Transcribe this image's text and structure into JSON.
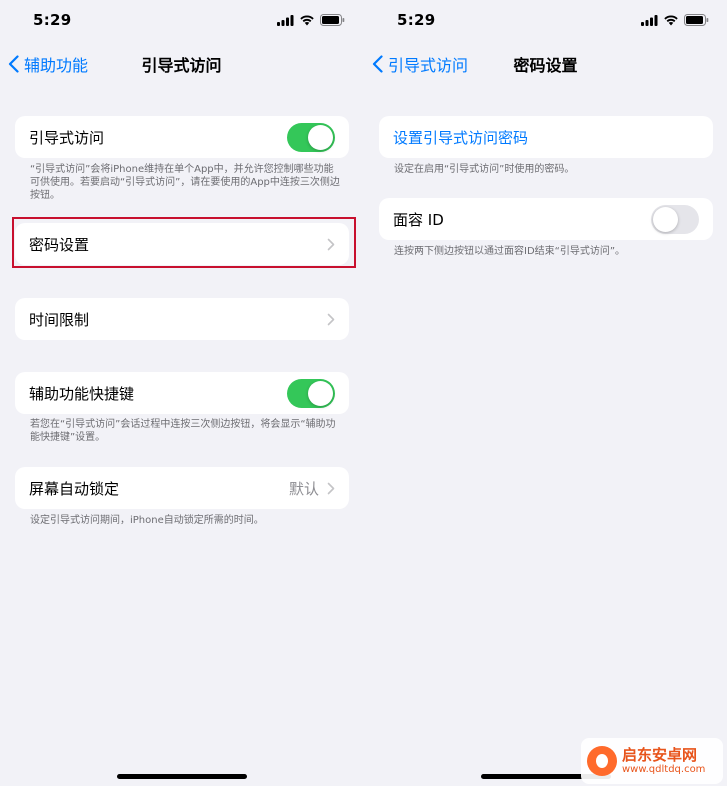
{
  "left": {
    "status_time": "5:29",
    "back_label": "辅助功能",
    "title": "引导式访问",
    "guided_access": {
      "label": "引导式访问",
      "toggle_on": true
    },
    "guided_access_footnote": "“引导式访问”会将iPhone维持在单个App中，并允许您控制哪些功能可供使用。若要启动“引导式访问”，请在要使用的App中连按三次侧边按钮。",
    "passcode_settings": {
      "label": "密码设置"
    },
    "time_limits": {
      "label": "时间限制"
    },
    "accessibility_shortcut": {
      "label": "辅助功能快捷键",
      "toggle_on": true
    },
    "accessibility_shortcut_footnote": "若您在“引导式访问”会话过程中连按三次侧边按钮，将会显示“辅助功能快捷键”设置。",
    "auto_lock": {
      "label": "屏幕自动锁定",
      "value": "默认"
    },
    "auto_lock_footnote": "设定引导式访问期间，iPhone自动锁定所需的时间。",
    "highlight_color": "#c8102e"
  },
  "right": {
    "status_time": "5:29",
    "back_label": "引导式访问",
    "title": "密码设置",
    "set_passcode": {
      "label": "设置引导式访问密码"
    },
    "set_passcode_footnote": "设定在启用“引导式访问”时使用的密码。",
    "face_id": {
      "label": "面容 ID",
      "toggle_on": false
    },
    "face_id_footnote": "连按两下侧边按钮以通过面容ID结束“引导式访问”。"
  },
  "watermark": {
    "name": "启东安卓网",
    "url": "www.qdltdq.com"
  },
  "colors": {
    "accent": "#007aff",
    "toggle_on": "#34c759",
    "background": "#f2f2f7"
  }
}
